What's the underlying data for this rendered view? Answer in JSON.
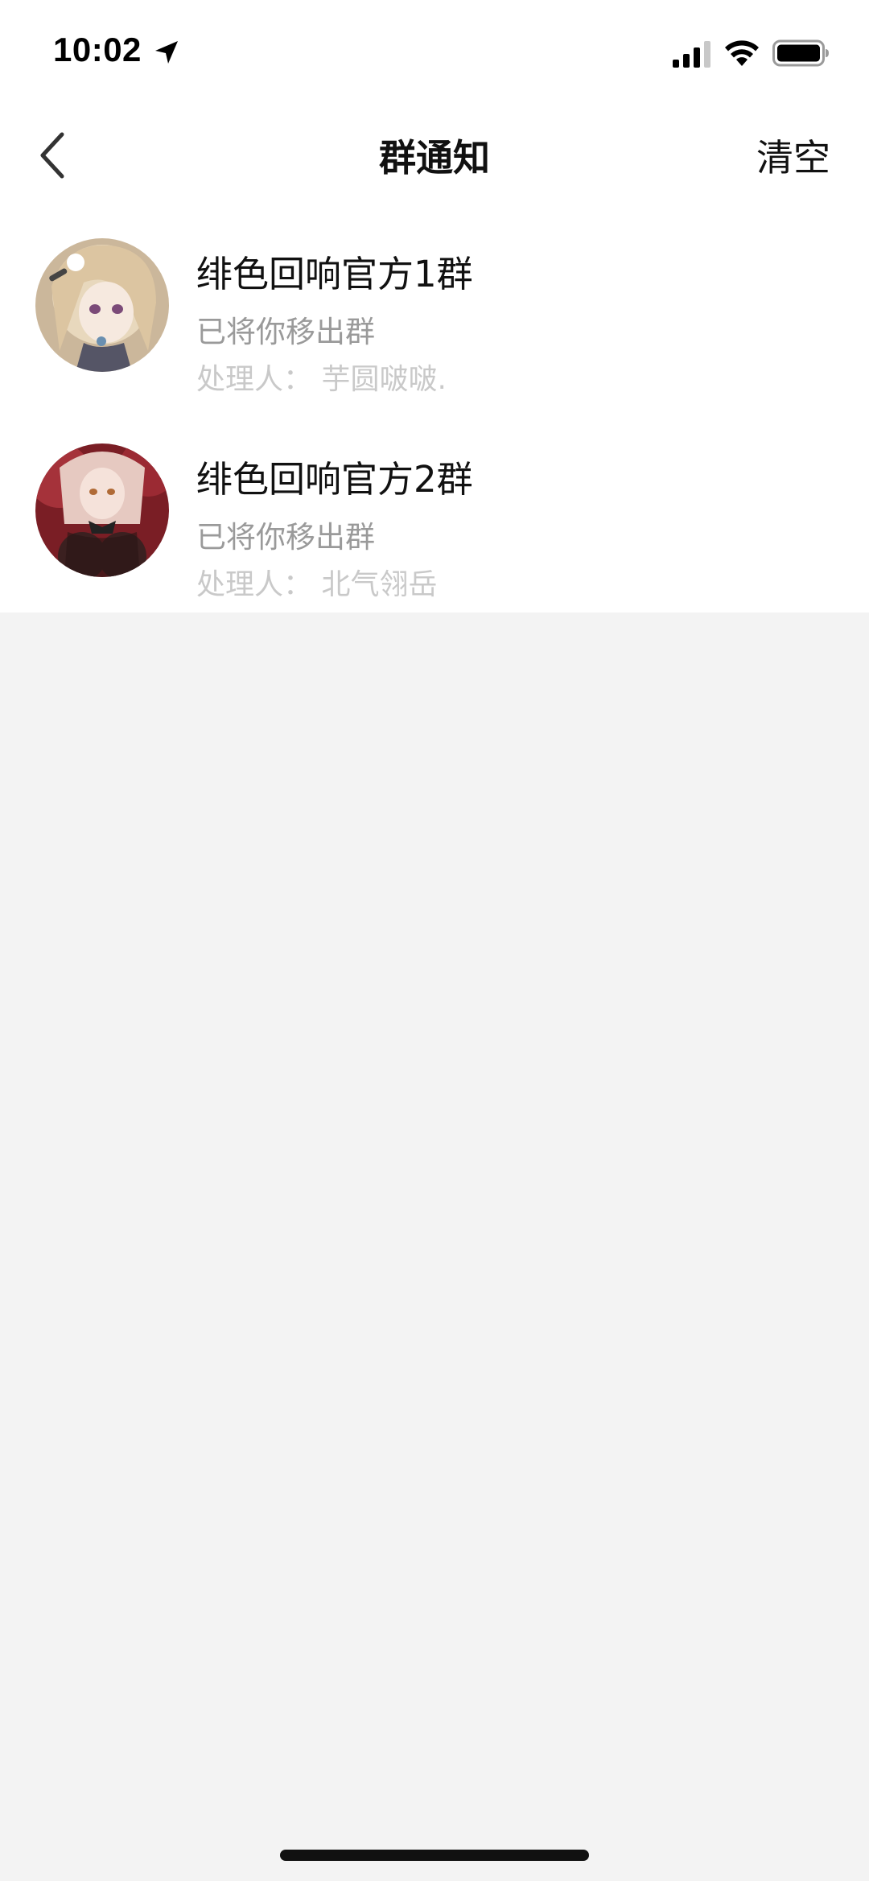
{
  "status_bar": {
    "time": "10:02"
  },
  "nav": {
    "title": "群通知",
    "clear_label": "清空"
  },
  "notifications": [
    {
      "group_name": "绯色回响官方1群",
      "message": "已将你移出群",
      "handler": "处理人： 芋圆啵啵."
    },
    {
      "group_name": "绯色回响官方2群",
      "message": "已将你移出群",
      "handler": "处理人： 北气翎岳"
    }
  ],
  "colors": {
    "background": "#f3f3f3",
    "card": "#ffffff",
    "title_text": "#111111",
    "message_text": "#9a9a9a",
    "handler_text": "#c9c9c9"
  }
}
